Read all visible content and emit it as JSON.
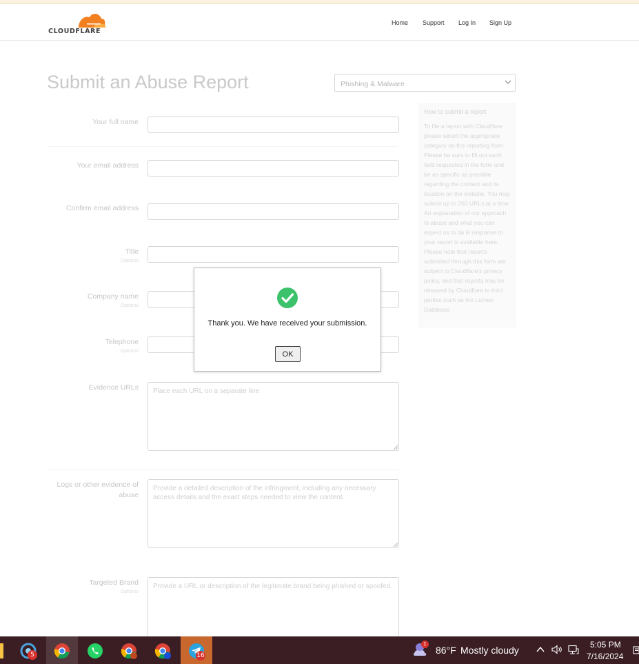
{
  "header": {
    "logo_text": "CLOUDFLARE",
    "nav": [
      "Home",
      "Support",
      "Log In",
      "Sign Up"
    ]
  },
  "page": {
    "title": "Submit an Abuse Report",
    "report_type_selected": "Phishing & Malware"
  },
  "form": {
    "optional_label": "Optional",
    "fields": {
      "full_name": "Your full name",
      "email": "Your email address",
      "confirm_email": "Confirm email address",
      "title": "Title",
      "company": "Company name",
      "telephone": "Telephone",
      "evidence_urls": "Evidence URLs",
      "logs_line1": "Logs or other evidence of",
      "logs_line2": "abuse",
      "targeted_brand": "Targeted Brand"
    },
    "placeholders": {
      "evidence_urls": "Place each URL on a separate line",
      "logs": "Provide a detailed description of the infringment, including any necessary access details and the exact steps needed to view the content.",
      "targeted_brand": "Provide a URL or description of the legitimate brand being phished or spoofed."
    }
  },
  "sidebar": {
    "title": "How to submit a report",
    "body": "To file a report with Cloudflare please select the appropriate category on the reporting form. Please be sure to fill out each field requested in the form and be as specific as possible regarding the content and its location on the website. You may submit up to 250 URLs at a time. An explanation of our approach to abuse and what you can expect us to do in response to your report is available here. Please note that reports submitted through this form are subject to Cloudflare's privacy policy, and that reports may be released by Cloudflare to third parties such as the Lumen Database."
  },
  "modal": {
    "message": "Thank you. We have received your submission.",
    "ok_label": "OK"
  },
  "taskbar": {
    "badges": {
      "app1": "5",
      "telegram": "16"
    },
    "weather_badge": "1",
    "weather_temp": "86°F",
    "weather_desc": "Mostly cloudy",
    "time": "5:05 PM",
    "date": "7/16/2024"
  },
  "colors": {
    "cloudflare_orange": "#f38020",
    "success_green": "#3cc26b",
    "taskbar_bg": "#3a1e24"
  }
}
